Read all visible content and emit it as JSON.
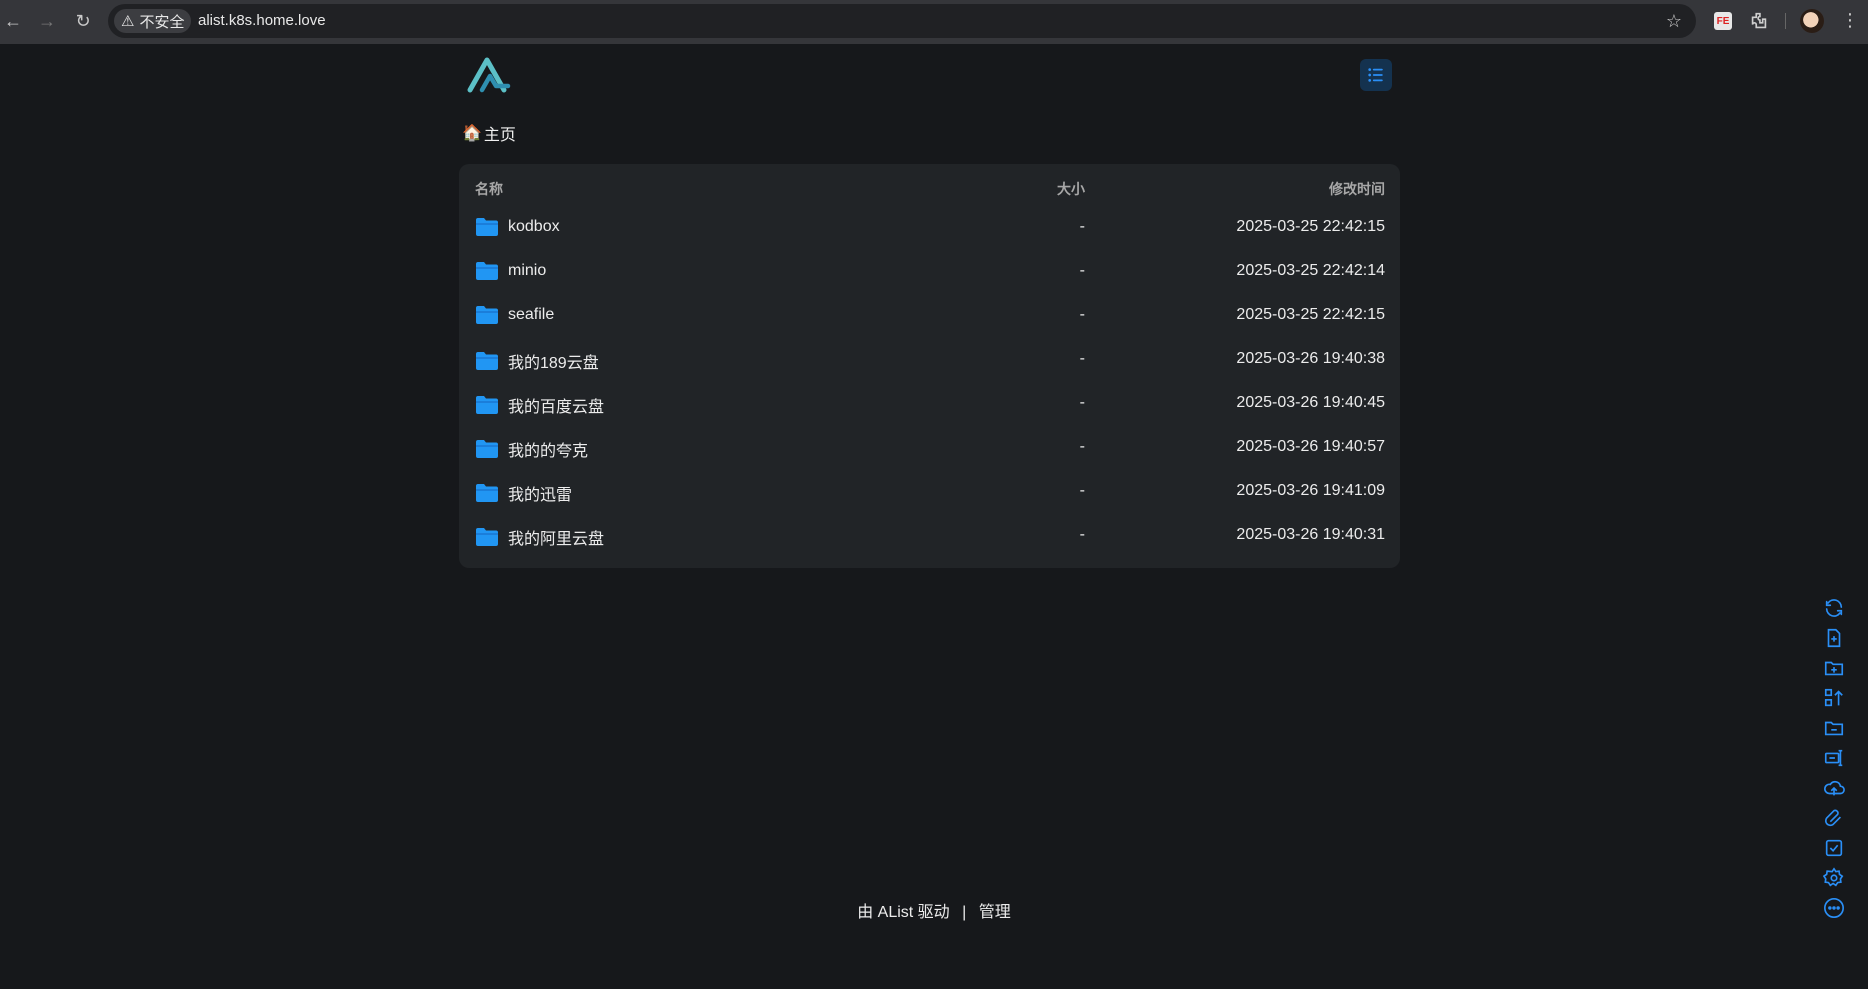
{
  "browser": {
    "security_label": "不安全",
    "url": "alist.k8s.home.love",
    "extension_label": "FE"
  },
  "breadcrumb": {
    "home_label": "主页"
  },
  "table": {
    "headers": {
      "name": "名称",
      "size": "大小",
      "modified": "修改时间"
    },
    "rows": [
      {
        "name": "kodbox",
        "size": "-",
        "modified": "2025-03-25 22:42:15"
      },
      {
        "name": "minio",
        "size": "-",
        "modified": "2025-03-25 22:42:14"
      },
      {
        "name": "seafile",
        "size": "-",
        "modified": "2025-03-25 22:42:15"
      },
      {
        "name": "我的189云盘",
        "size": "-",
        "modified": "2025-03-26 19:40:38"
      },
      {
        "name": "我的百度云盘",
        "size": "-",
        "modified": "2025-03-26 19:40:45"
      },
      {
        "name": "我的的夸克",
        "size": "-",
        "modified": "2025-03-26 19:40:57"
      },
      {
        "name": "我的迅雷",
        "size": "-",
        "modified": "2025-03-26 19:41:09"
      },
      {
        "name": "我的阿里云盘",
        "size": "-",
        "modified": "2025-03-26 19:40:31"
      }
    ]
  },
  "footer": {
    "powered_by": "由 AList 驱动",
    "separator": "|",
    "manage": "管理"
  },
  "tools": [
    "refresh-icon",
    "new-file-icon",
    "new-folder-icon",
    "recursive-move-icon",
    "remove-empty-folder-icon",
    "batch-rename-icon",
    "upload-icon",
    "offline-download-icon",
    "select-icon",
    "settings-icon",
    "more-icon"
  ],
  "colors": {
    "accent": "#1e88e5",
    "folder": "#2196f3",
    "background": "#16181b",
    "panel": "#212427"
  }
}
